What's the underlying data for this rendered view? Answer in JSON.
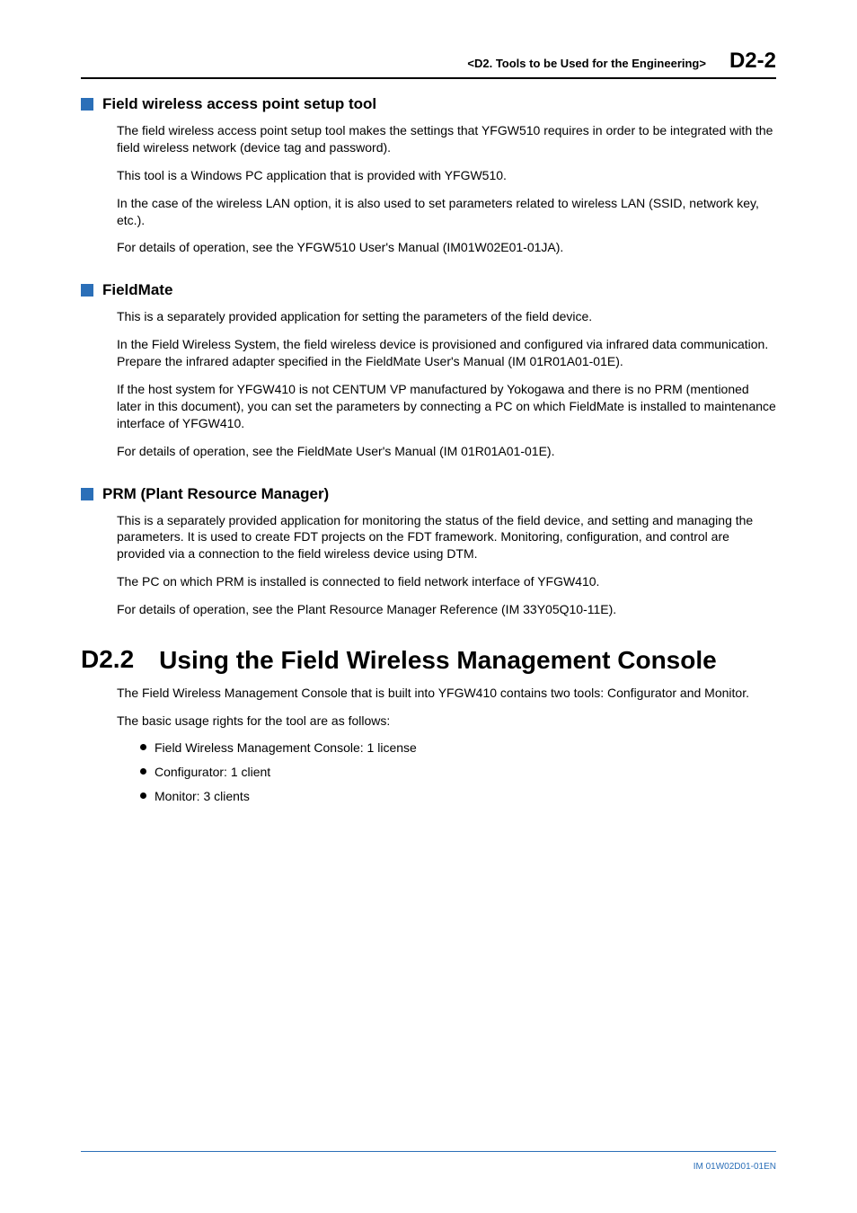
{
  "header": {
    "title": "<D2.  Tools to be Used for the Engineering>",
    "page": "D2-2"
  },
  "sections": [
    {
      "title": "Field wireless access point setup tool",
      "paragraphs": [
        "The field wireless access point setup tool makes the settings that YFGW510 requires in order to be integrated with the field wireless network (device tag and password).",
        "This tool is a Windows PC application that is provided with YFGW510.",
        "In the case of the wireless LAN option, it is also used to set parameters related to wireless LAN (SSID, network key, etc.).",
        "For details of operation, see the YFGW510 User's Manual (IM01W02E01-01JA)."
      ]
    },
    {
      "title": "FieldMate",
      "paragraphs": [
        "This is a separately provided application for setting the parameters of the field device.",
        "In the Field Wireless System, the field wireless device is provisioned and configured via infrared data communication. Prepare the infrared adapter specified in the FieldMate User's Manual (IM 01R01A01-01E).",
        "If the host system for YFGW410 is not CENTUM VP manufactured by Yokogawa and there is no PRM (mentioned later in this document), you can set the parameters by connecting a PC on which FieldMate is installed to maintenance interface of YFGW410.",
        "For details of operation, see the FieldMate User's Manual (IM 01R01A01-01E)."
      ]
    },
    {
      "title": "PRM (Plant Resource Manager)",
      "paragraphs": [
        "This is a separately provided application for monitoring the status of the field device, and setting and managing the parameters. It is used to create FDT projects on the FDT framework. Monitoring, configuration, and control are provided via a connection to the field wireless device using DTM.",
        "The PC on which PRM is installed is connected to field network interface of YFGW410.",
        "For details of operation, see the Plant Resource Manager Reference (IM 33Y05Q10-11E)."
      ]
    }
  ],
  "chapter": {
    "num": "D2.2",
    "title": "Using the Field Wireless Management Console",
    "paragraphs": [
      "The Field Wireless Management Console that is built into YFGW410 contains two tools:  Configurator and Monitor.",
      "The basic usage rights for the tool are as follows:"
    ],
    "bullets": [
      "Field Wireless Management Console: 1 license",
      "Configurator: 1 client",
      "Monitor: 3 clients"
    ]
  },
  "footer": "IM 01W02D01-01EN"
}
